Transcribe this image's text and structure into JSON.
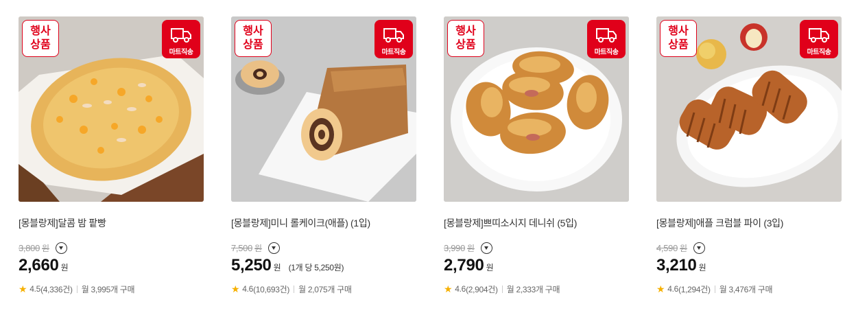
{
  "badges": {
    "event_line1": "행사",
    "event_line2": "상품",
    "delivery": "마트직송"
  },
  "currency_unit": "원",
  "products": [
    {
      "title": "[몽블랑제]달콤 밤 팥빵",
      "original_price": "3,800",
      "price": "2,660",
      "unit_price": "",
      "rating": "4.5",
      "review_count": "(4,336건)",
      "monthly_purchases": "월 3,995개 구매"
    },
    {
      "title": "[몽블랑제]미니 롤케이크(애플) (1입)",
      "original_price": "7,500",
      "price": "5,250",
      "unit_price": "(1개 당 5,250원)",
      "rating": "4.6",
      "review_count": "(10,693건)",
      "monthly_purchases": "월 2,075개 구매"
    },
    {
      "title": "[몽블랑제]쁘띠소시지 데니쉬 (5입)",
      "original_price": "3,990",
      "price": "2,790",
      "unit_price": "",
      "rating": "4.6",
      "review_count": "(2,904건)",
      "monthly_purchases": "월 2,333개 구매"
    },
    {
      "title": "[몽블랑제]애플 크럼블 파이 (3입)",
      "original_price": "4,590",
      "price": "3,210",
      "unit_price": "",
      "rating": "4.6",
      "review_count": "(1,294건)",
      "monthly_purchases": "월 3,476개 구매"
    }
  ],
  "colors": {
    "badge_red": "#e0001a",
    "star": "#f6b000"
  }
}
